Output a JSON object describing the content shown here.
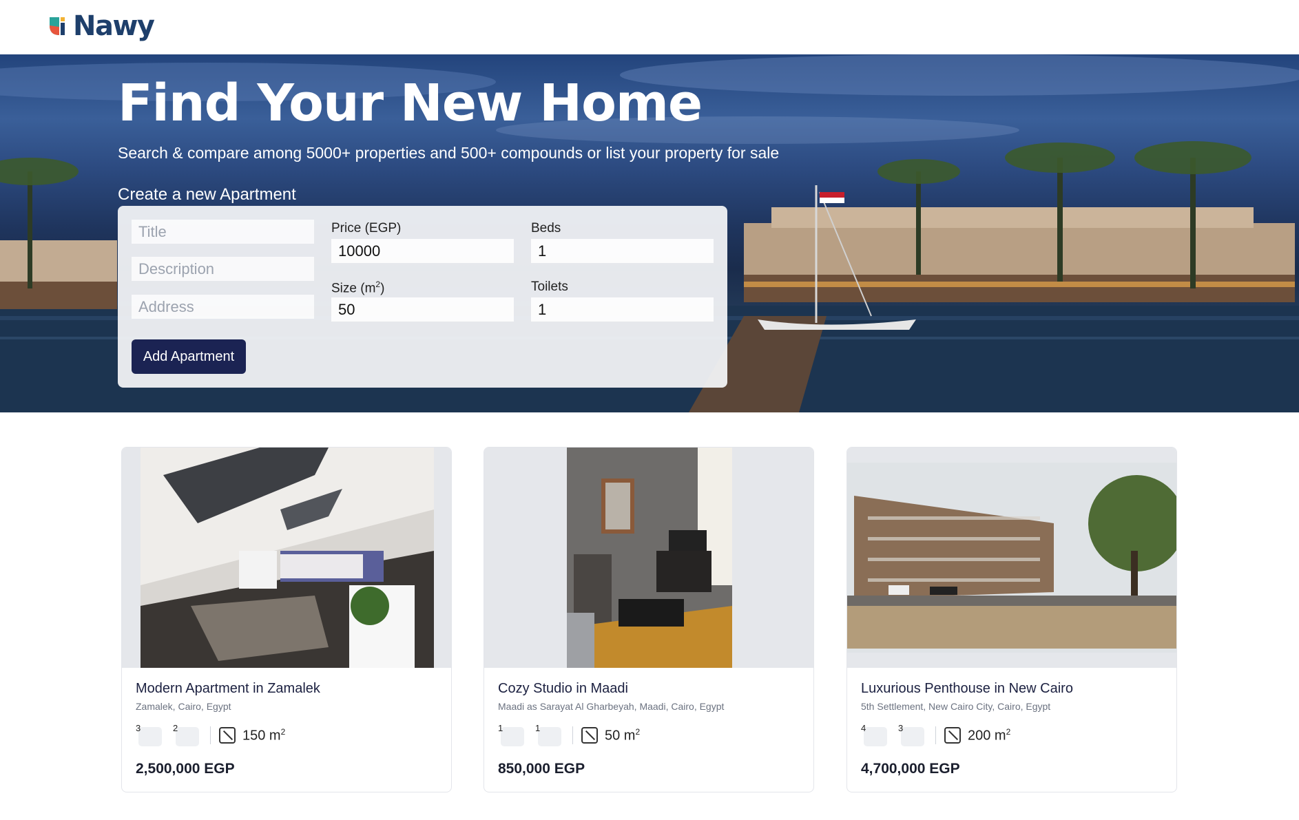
{
  "header": {
    "logo_text": "Nawy",
    "logo_colors": [
      "#e8553c",
      "#2aa39a",
      "#f2b233",
      "#1e3f6b"
    ]
  },
  "hero": {
    "title": "Find Your New Home",
    "subtitle": "Search & compare among 5000+ properties and 500+ compounds or list your property for sale"
  },
  "form": {
    "heading": "Create a new Apartment",
    "title_placeholder": "Title",
    "description_placeholder": "Description",
    "address_placeholder": "Address",
    "price_label": "Price (EGP)",
    "price_value": "10000",
    "beds_label": "Beds",
    "beds_value": "1",
    "size_label": "Size (m",
    "size_label_sup": "2",
    "size_label_end": ")",
    "size_value": "50",
    "toilets_label": "Toilets",
    "toilets_value": "1",
    "submit_label": "Add Apartment"
  },
  "listings": [
    {
      "title": "Modern Apartment in Zamalek",
      "location": "Zamalek, Cairo, Egypt",
      "beds": "3",
      "baths": "2",
      "area": "150 m",
      "area_sup": "2",
      "price": "2,500,000 EGP",
      "image": "bedroom-photo"
    },
    {
      "title": "Cozy Studio in Maadi",
      "location": "Maadi as Sarayat Al Gharbeyah, Maadi, Cairo, Egypt",
      "beds": "1",
      "baths": "1",
      "area": "50 m",
      "area_sup": "2",
      "price": "850,000 EGP",
      "image": "living-room-photo"
    },
    {
      "title": "Luxurious Penthouse in New Cairo",
      "location": "5th Settlement, New Cairo City, Cairo, Egypt",
      "beds": "4",
      "baths": "3",
      "area": "200 m",
      "area_sup": "2",
      "price": "4,700,000 EGP",
      "image": "building-exterior-photo"
    }
  ],
  "colors": {
    "primary_button": "#1b2353",
    "card_border": "#e3e5ea"
  }
}
